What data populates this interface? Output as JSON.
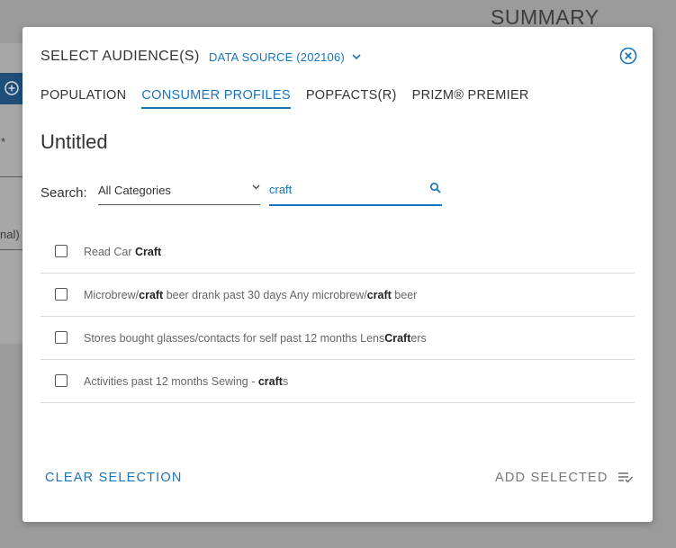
{
  "background": {
    "summary_heading": "SUMMARY",
    "partial_asterisk": "*",
    "partial_text": "nal)"
  },
  "modal": {
    "title": "SELECT AUDIENCE(S)",
    "data_source_label": "DATA SOURCE (202106)",
    "tabs": [
      {
        "label": "POPULATION",
        "active": false
      },
      {
        "label": "CONSUMER PROFILES",
        "active": true
      },
      {
        "label": "POPFACTS(R)",
        "active": false
      },
      {
        "label": "PRIZM® PREMIER",
        "active": false
      }
    ],
    "audience_name": "Untitled",
    "search": {
      "label": "Search:",
      "category_selected": "All Categories",
      "query": "craft"
    },
    "results": [
      {
        "segments": [
          {
            "t": "Read Car ",
            "b": false
          },
          {
            "t": "Craft",
            "b": true
          }
        ],
        "checked": false
      },
      {
        "segments": [
          {
            "t": "Microbrew/",
            "b": false
          },
          {
            "t": "craft",
            "b": true
          },
          {
            "t": " beer drank past 30 days Any microbrew/",
            "b": false
          },
          {
            "t": "craft",
            "b": true
          },
          {
            "t": " beer",
            "b": false
          }
        ],
        "checked": false
      },
      {
        "segments": [
          {
            "t": "Stores bought glasses/contacts for self past 12 months Lens",
            "b": false
          },
          {
            "t": "Craft",
            "b": true
          },
          {
            "t": "ers",
            "b": false
          }
        ],
        "checked": false
      },
      {
        "segments": [
          {
            "t": "Activities past 12 months Sewing - ",
            "b": false
          },
          {
            "t": "craft",
            "b": true
          },
          {
            "t": "s",
            "b": false
          }
        ],
        "checked": false
      }
    ],
    "clear_label": "CLEAR SELECTION",
    "add_label": "ADD SELECTED"
  },
  "colors": {
    "accent": "#1a75b8",
    "overlay": "#9b9b9b"
  }
}
